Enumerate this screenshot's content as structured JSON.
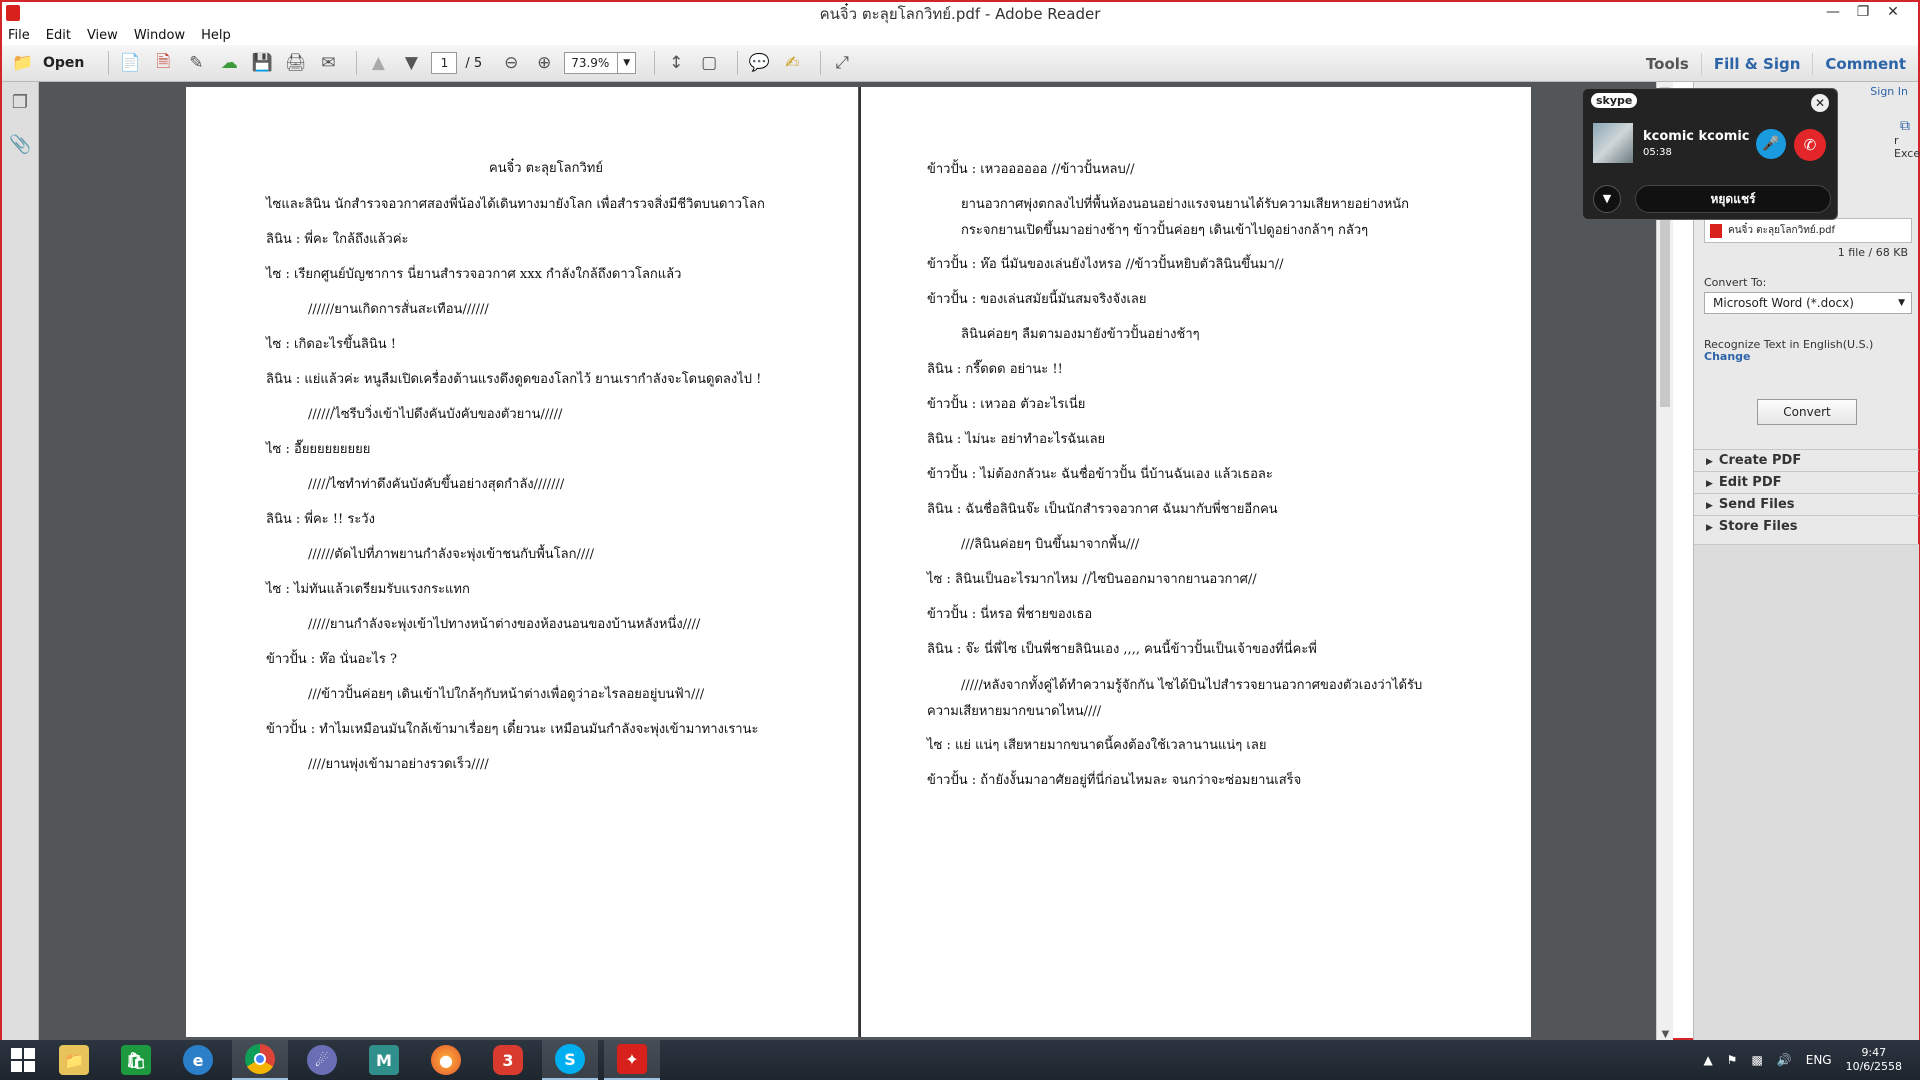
{
  "window": {
    "title": "คนจิ๋ว ตะลุยโลกวิทย์.pdf - Adobe Reader"
  },
  "menubar": [
    "File",
    "Edit",
    "View",
    "Window",
    "Help"
  ],
  "toolbar": {
    "open_label": "Open",
    "page_current": "1",
    "page_total": "/ 5",
    "zoom": "73.9%",
    "tools_label": "Tools",
    "fill_sign_label": "Fill & Sign",
    "comment_label": "Comment"
  },
  "page_left": [
    "คนจิ๋ว ตะลุยโลกวิทย์",
    "ไซและลินิน นักสำรวจอวกาศสองพี่น้องได้เดินทางมายังโลก เพื่อสำรวจสิ่งมีชีวิตบนดาวโลก",
    "ลินิน : พี่คะ ใกล้ถึงแล้วค่ะ",
    "ไซ : เรียกศูนย์บัญชาการ นี่ยานสำรวจอวกาศ xxx กำลังใกล้ถึงดาวโลกแล้ว",
    "//////ยานเกิดการสั่นสะเทือน//////",
    "ไซ : เกิดอะไรขึ้นลินิน !",
    "ลินิน : แย่แล้วค่ะ หนูลืมเปิดเครื่องต้านแรงดึงดูดของโลกไว้ ยานเรากำลังจะโดนดูดลงไป !",
    "//////ไซรีบวิ่งเข้าไปดึงคันบังคับของตัวยาน/////",
    "ไซ : อื๊ยยยยยยยยย",
    "/////ไซทำท่าดึงคันบังคับขึ้นอย่างสุดกำลัง///////",
    "ลินิน : พี่คะ !! ระวัง",
    "//////ตัดไปที่ภาพยานกำลังจะพุ่งเข้าชนกับพื้นโลก////",
    "ไซ : ไม่ทันแล้วเตรียมรับแรงกระแทก",
    "/////ยานกำลังจะพุ่งเข้าไปทางหน้าต่างของห้องนอนของบ้านหลังหนึ่ง////",
    "ข้าวปั้น : ห๊อ นั่นอะไร ?",
    "///ข้าวปั้นค่อยๆ เดินเข้าไปใกล้ๆกับหน้าต่างเพื่อดูว่าอะไรลอยอยู่บนฟ้า///",
    "ข้าวปั้น : ทำไมเหมือนมันใกล้เข้ามาเรื่อยๆ เดี๋ยวนะ เหมือนมันกำลังจะพุ่งเข้ามาทางเรานะ",
    "////ยานพุ่งเข้ามาอย่างรวดเร็ว////"
  ],
  "page_right": [
    "ข้าวปั้น : เหวออออออ //ข้าวปั้นหลบ//",
    "ยานอวกาศพุ่งตกลงไปที่พื้นห้องนอนอย่างแรงจนยานได้รับความเสียหายอย่างหนัก",
    "กระจกยานเปิดขึ้นมาอย่างช้าๆ ข้าวปั้นค่อยๆ เดินเข้าไปดูอย่างกล้าๆ กลัวๆ",
    "ข้าวปั้น : ห๊อ นี่มันของเล่นยังไงหรอ //ข้าวปั้นหยิบตัวลินินขึ้นมา//",
    "ข้าวปั้น : ของเล่นสมัยนี้มันสมจริงจังเลย",
    "ลินินค่อยๆ ลืมตามองมายังข้าวปั้นอย่างช้าๆ",
    "ลินิน : กรี๊ดดด อย่านะ !!",
    "ข้าวปั้น : เหวออ ตัวอะไรเนี่ย",
    "ลินิน : ไม่นะ อย่าทำอะไรฉันเลย",
    "ข้าวปั้น : ไม่ต้องกลัวนะ ฉันชื่อข้าวปั้น นี่บ้านฉันเอง แล้วเธอละ",
    "ลินิน : ฉันชื่อลินินจ๊ะ เป็นนักสำรวจอวกาศ ฉันมากับพี่ชายอีกคน",
    "///ลินินค่อยๆ บินขึ้นมาจากพื้น///",
    "ไซ : ลินินเป็นอะไรมากไหม //ไซบินออกมาจากยานอวกาศ//",
    "ข้าวปั้น : นี่หรอ พี่ชายของเธอ",
    "ลินิน : จ๊ะ นี่พี่ไซ เป็นพี่ชายลินินเอง ,,,, คนนี้ข้าวปั้นเป็นเจ้าของที่นี่คะพี่",
    "/////หลังจากทั้งคู่ได้ทำความรู้จักกัน ไซได้บินไปสำรวจยานอวกาศของตัวเองว่าได้รับ",
    "ความเสียหายมากขนาดไหน////",
    "ไซ : แย่ แน่ๆ เสียหายมากขนาดนี้คงต้องใช้เวลานานแน่ๆ เลย",
    "ข้าวปั้น : ถ้ายังงั้นมาอาศัยอยู่ที่นี่ก่อนไหมละ จนกว่าจะซ่อมยานเสร็จ"
  ],
  "right_panel": {
    "sign_in": "Sign In",
    "excel_fragment": "r Excel",
    "file_name": "คนจิ๋ว ตะลุยโลกวิทย์.pdf",
    "file_info": "1 file / 68 KB",
    "convert_to_label": "Convert To:",
    "convert_to_value": "Microsoft Word (*.docx)",
    "recognize_text": "Recognize Text in English(U.S.)",
    "change_link": "Change",
    "convert_button": "Convert",
    "sections": [
      "Create PDF",
      "Edit PDF",
      "Send Files",
      "Store Files"
    ]
  },
  "skype": {
    "logo": "skype",
    "caller_name": "kcomic kcomic",
    "duration": "05:38",
    "stop_label": "หยุดแชร์"
  },
  "taskbar": {
    "apps": [
      "file-explorer",
      "store",
      "internet-explorer",
      "chrome",
      "media-player",
      "maya",
      "firefox",
      "app-3",
      "skype",
      "adobe-reader"
    ],
    "language": "ENG",
    "time": "9:47",
    "date": "10/6/2558"
  }
}
